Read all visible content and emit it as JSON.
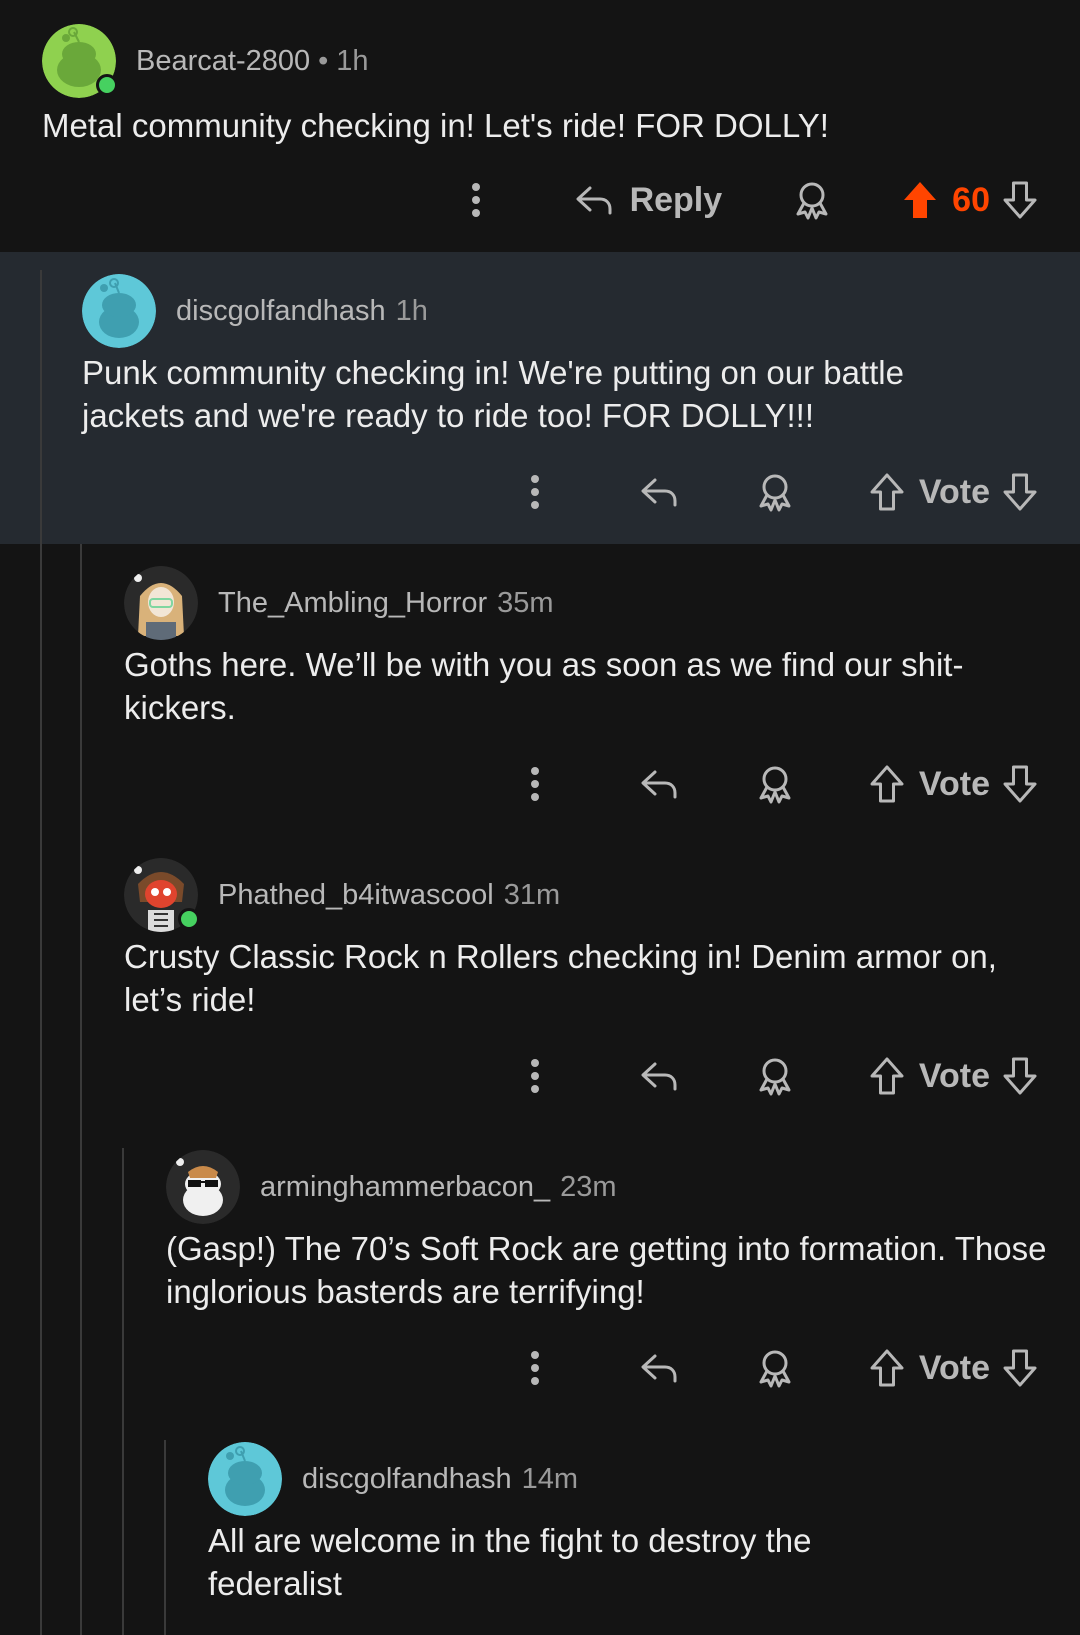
{
  "comments": [
    {
      "username": "Bearcat-2800",
      "separator": "•",
      "time": "1h",
      "text": "Metal community checking in! Let's ride! FOR DOLLY!",
      "reply_label": "Reply",
      "vote_count": "60",
      "upvoted": true,
      "online": true,
      "avatar_color": "#8fd14f"
    },
    {
      "username": "discgolfandhash",
      "time": "1h",
      "text": "Punk community checking in! We're putting on our battle jackets and we're ready to ride too! FOR DOLLY!!!",
      "vote_label": "Vote",
      "online": false,
      "avatar_color": "#5ec8d8",
      "highlighted": true
    },
    {
      "username": "The_Ambling_Horror",
      "time": "35m",
      "text": "Goths here. We’ll be with you as soon as we find our shit-kickers.",
      "vote_label": "Vote",
      "online": false
    },
    {
      "username": "Phathed_b4itwascool",
      "time": "31m",
      "text": "Crusty Classic Rock n Rollers checking in! Denim armor on, let’s ride!",
      "vote_label": "Vote",
      "online": true
    },
    {
      "username": "arminghammerbacon_",
      "time": "23m",
      "text": "(Gasp!) The 70’s Soft Rock are getting into formation. Those inglorious basterds are terrifying!",
      "vote_label": "Vote",
      "online": false
    },
    {
      "username": "discgolfandhash",
      "time": "14m",
      "text": "All are welcome in the fight to destroy the federalist",
      "online": false,
      "avatar_color": "#5ec8d8"
    }
  ],
  "colors": {
    "background": "#141414",
    "highlight_background": "#252a30",
    "upvote_orange": "#ff4500",
    "online_green": "#46d160",
    "muted_text": "#b8b8b8"
  },
  "icons": [
    "more-options-icon",
    "reply-arrow-icon",
    "award-icon",
    "upvote-arrow-icon",
    "downvote-arrow-icon"
  ]
}
